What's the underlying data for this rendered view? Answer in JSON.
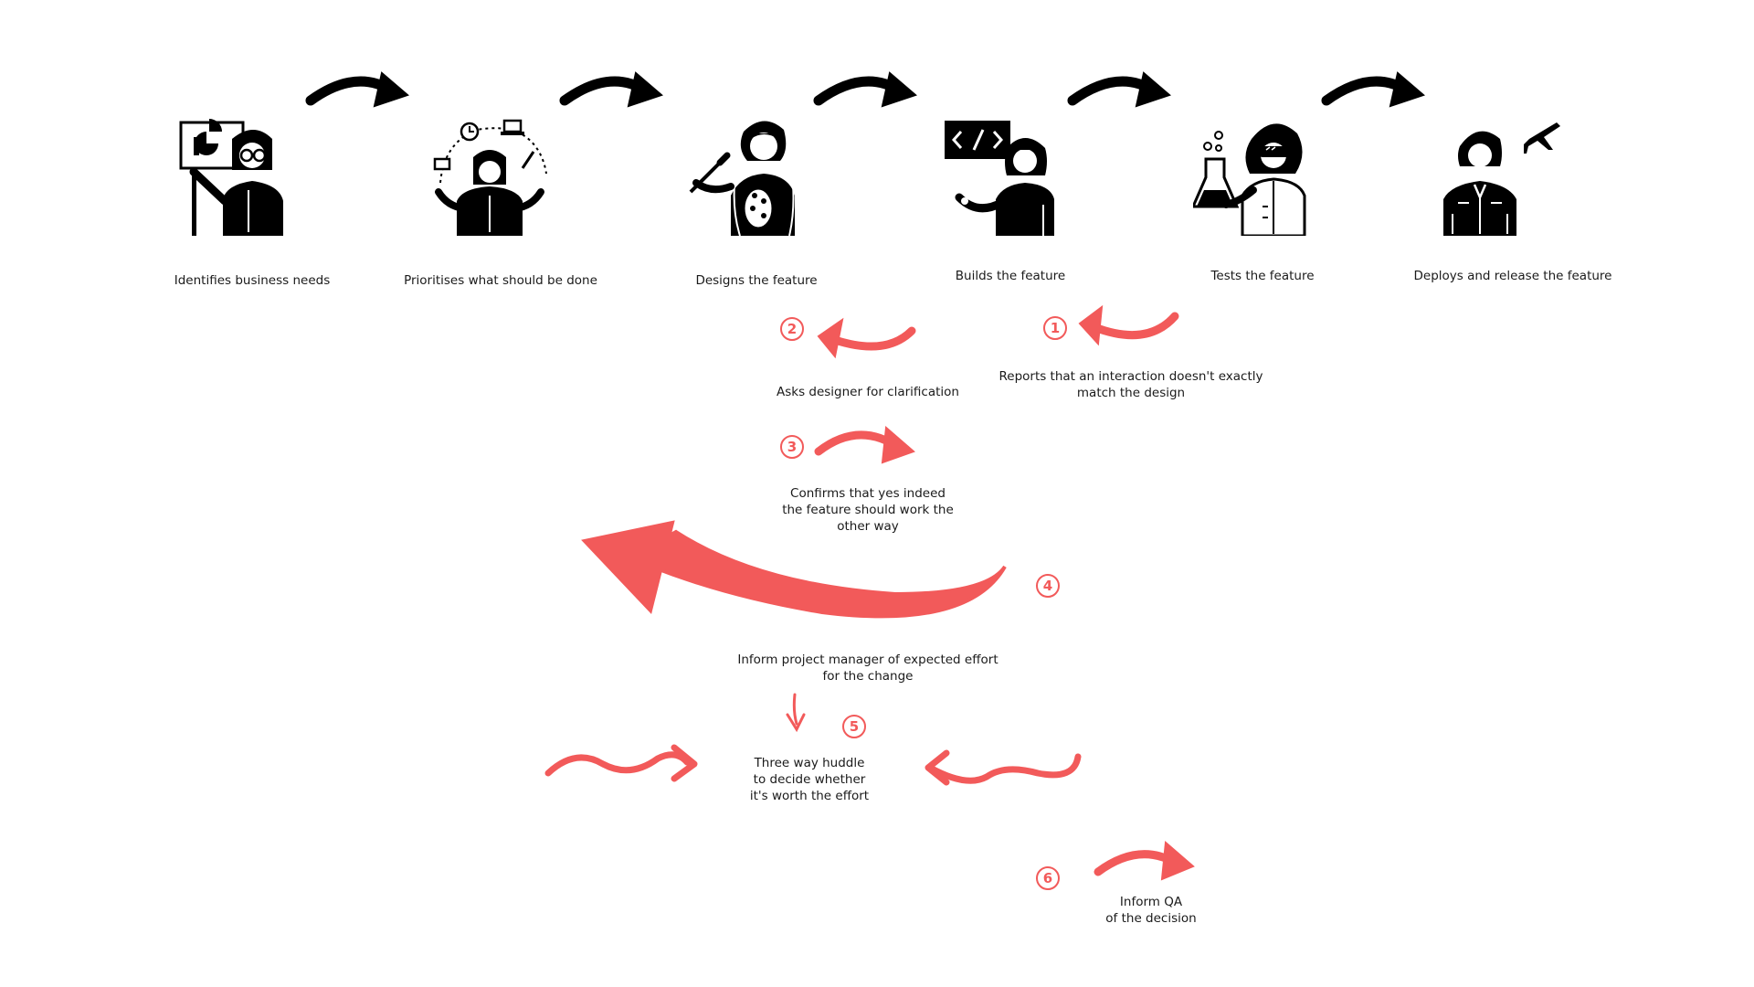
{
  "colors": {
    "accent": "#f25a5a",
    "ink": "#000000",
    "background": "#ffffff"
  },
  "roles": [
    {
      "label": "Identifies business needs",
      "icon": "presenter-person-icon"
    },
    {
      "label": "Prioritises what should be done",
      "icon": "juggling-tasks-person-icon"
    },
    {
      "label": "Designs the feature",
      "icon": "painter-with-palette-icon"
    },
    {
      "label": "Builds the feature",
      "icon": "developer-code-screen-icon"
    },
    {
      "label": "Tests the feature",
      "icon": "scientist-with-flask-icon"
    },
    {
      "label": "Deploys and release the feature",
      "icon": "pilot-with-airplane-icon"
    }
  ],
  "steps": [
    {
      "number": "1",
      "text": "Reports that an interaction doesn't exactly\nmatch the design"
    },
    {
      "number": "2",
      "text": "Asks designer for clarification"
    },
    {
      "number": "3",
      "text": "Confirms that yes indeed\nthe feature should work the\nother way"
    },
    {
      "number": "4",
      "text": "Inform project manager of expected effort\nfor the change"
    },
    {
      "number": "5",
      "text": "Three way huddle\nto decide whether\nit's worth the effort"
    },
    {
      "number": "6",
      "text": "Inform  QA\nof the decision"
    }
  ]
}
